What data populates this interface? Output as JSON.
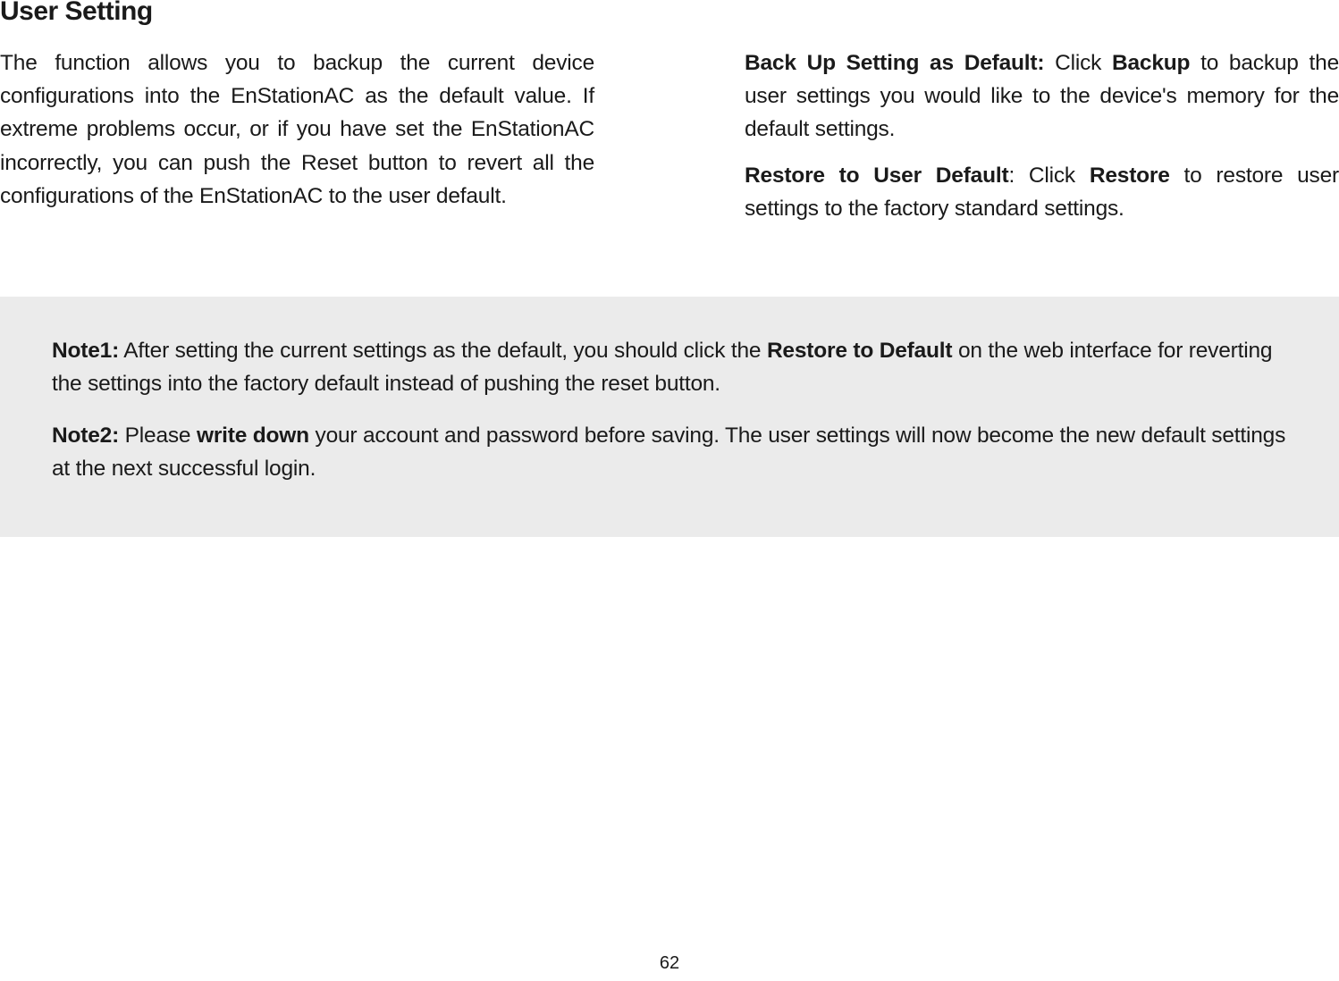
{
  "title": "User Setting",
  "leftParagraph": "The function allows you to backup the current device configurations into the EnStationAC as the default value. If extreme problems occur, or if you have set the EnStationAC incorrectly, you can push the Reset button to revert all the configurations of the EnStationAC to the user default.",
  "rightPara1": {
    "boldLead": "Back Up Setting as Default:",
    "mid": "  Click ",
    "boldAction": "Backup",
    "tail": " to backup the user settings you would like to the device's memory for the default settings."
  },
  "rightPara2": {
    "boldLead": "Restore to User Default",
    "mid": ": Click ",
    "boldAction": "Restore",
    "tail": " to restore user settings to the factory standard settings."
  },
  "note1": {
    "label": "Note1:",
    "pre": " After setting the current settings as the default, you should click the ",
    "bold": "Restore to Default",
    "post": " on the web interface for reverting the settings into the factory default instead of pushing the reset button."
  },
  "note2": {
    "label": "Note2:",
    "pre": " Please ",
    "bold": "write down",
    "post": " your account and password before saving. The user settings will now become the new default settings at the next successful login."
  },
  "pageNumber": "62"
}
